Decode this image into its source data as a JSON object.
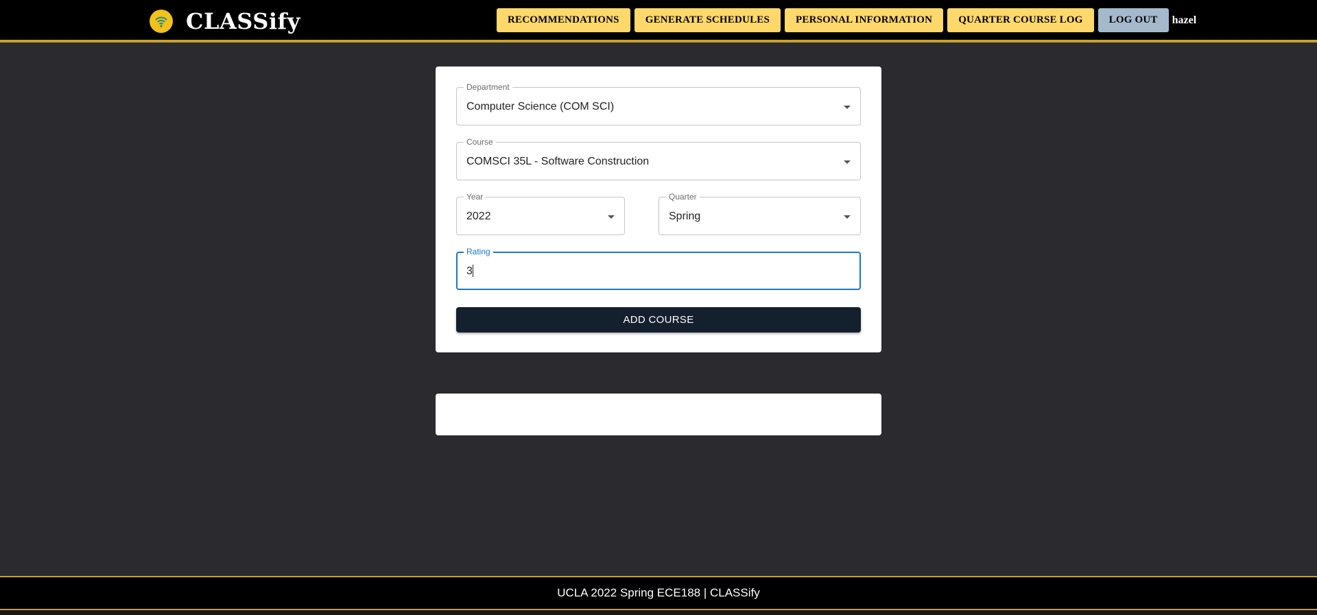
{
  "header": {
    "app_title": "CLASSify",
    "logo_icon": "wifi-signal-icon",
    "nav": [
      {
        "label": "RECOMMENDATIONS"
      },
      {
        "label": "GENERATE SCHEDULES"
      },
      {
        "label": "PERSONAL INFORMATION"
      },
      {
        "label": "QUARTER COURSE LOG"
      }
    ],
    "logout_label": "LOG OUT",
    "username": "hazel"
  },
  "form": {
    "department": {
      "label": "Department",
      "value": "Computer Science (COM SCI)"
    },
    "course": {
      "label": "Course",
      "value": "COMSCI 35L - Software Construction"
    },
    "year": {
      "label": "Year",
      "value": "2022"
    },
    "quarter": {
      "label": "Quarter",
      "value": "Spring"
    },
    "rating": {
      "label": "Rating",
      "value": "3"
    },
    "submit_label": "ADD COURSE"
  },
  "footer": {
    "text": "UCLA 2022 Spring ECE188 | CLASSify"
  },
  "colors": {
    "nav_button": "#ffd86b",
    "logout_button": "#a4b9cc",
    "accent_gold": "#c9a227",
    "focus_blue": "#1976d2",
    "submit_button": "#14202e",
    "page_background": "#2a2a2f"
  }
}
